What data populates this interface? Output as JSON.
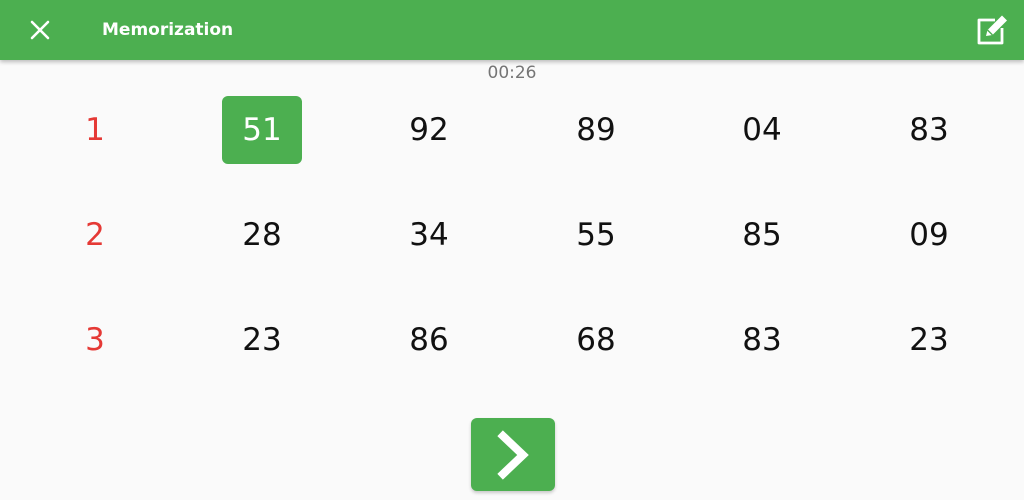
{
  "app": {
    "title": "Memorization",
    "accent_color": "#4caf50",
    "label_color": "#e53935"
  },
  "toolbar": {
    "close_icon": "close-icon",
    "edit_icon": "edit-icon"
  },
  "timer": "00:26",
  "rows": [
    {
      "label": "1",
      "values": [
        "51",
        "92",
        "89",
        "04",
        "83"
      ]
    },
    {
      "label": "2",
      "values": [
        "28",
        "34",
        "55",
        "85",
        "09"
      ]
    },
    {
      "label": "3",
      "values": [
        "23",
        "86",
        "68",
        "83",
        "23"
      ]
    }
  ],
  "selected": {
    "row": 1,
    "column": 1
  },
  "next_button": {
    "icon": "chevron-right-icon"
  }
}
